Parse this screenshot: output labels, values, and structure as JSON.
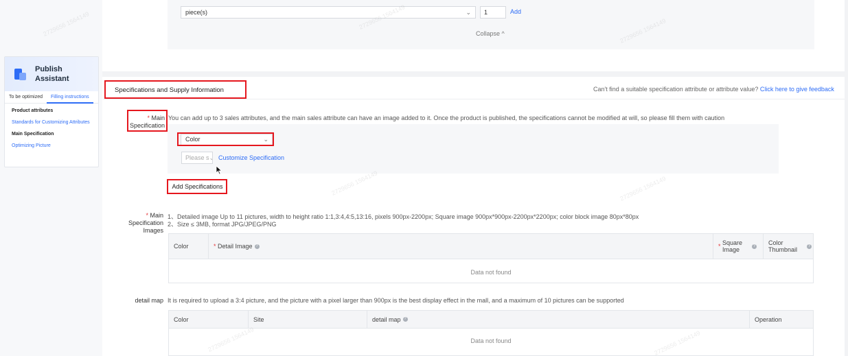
{
  "assistant": {
    "title_line1": "Publish",
    "title_line2": "Assistant",
    "tabs": [
      "To be optimized",
      "Filling instructions"
    ],
    "items": [
      {
        "label": "Product attributes"
      },
      {
        "label": "Standards for Customizing Attributes"
      },
      {
        "label": "Main Specification"
      },
      {
        "label": "Optimizing Picture"
      }
    ]
  },
  "quantity": {
    "unit_value": "piece(s)",
    "number_value": "1",
    "add_label": "Add",
    "collapse_label": "Collapse ^"
  },
  "section": {
    "title": "Specifications and Supply Information",
    "feedback_text": "Can't find a suitable specification attribute or attribute value?",
    "feedback_link": "Click here to give feedback"
  },
  "main_spec": {
    "label_line1": "Main",
    "label_line2": "Specification",
    "description": "You can add up to 3 sales attributes, and the main sales attribute can have an image added to it. Once the product is published, the specifications cannot be modified at will, so please fill them with caution",
    "color_select_value": "Color",
    "please_select_placeholder": "Please s",
    "customize_label": "Customize Specification",
    "add_specifications_label": "Add Specifications"
  },
  "spec_images": {
    "label_line1": "Main",
    "label_line2": "Specification",
    "label_line3": "Images",
    "rule1": "1、Detailed image Up to 11 pictures, width to height ratio 1:1,3:4,4:5,13:16, pixels 900px-2200px; Square image 900px*900px-2200px*2200px; color block image 80px*80px",
    "rule2": "2、Size ≤ 3MB, format JPG/JPEG/PNG",
    "columns": {
      "color": "Color",
      "detail_image": "Detail Image",
      "square_image_line1": "Square",
      "square_image_line2": "Image",
      "color_thumbnail_line1": "Color",
      "color_thumbnail_line2": "Thumbnail"
    },
    "empty_text": "Data not found"
  },
  "detail_map": {
    "label": "detail map",
    "description": "It is required to upload a 3:4 picture, and the picture with a pixel larger than 900px is the best display effect in the mall, and a maximum of 10 pictures can be supported",
    "columns": {
      "color": "Color",
      "site": "Site",
      "detail_map": "detail map",
      "operation": "Operation"
    },
    "empty_text": "Data not found"
  },
  "colors": {
    "accent": "#2d6cf6",
    "highlight": "#e5161d",
    "required": "#e4393c"
  }
}
